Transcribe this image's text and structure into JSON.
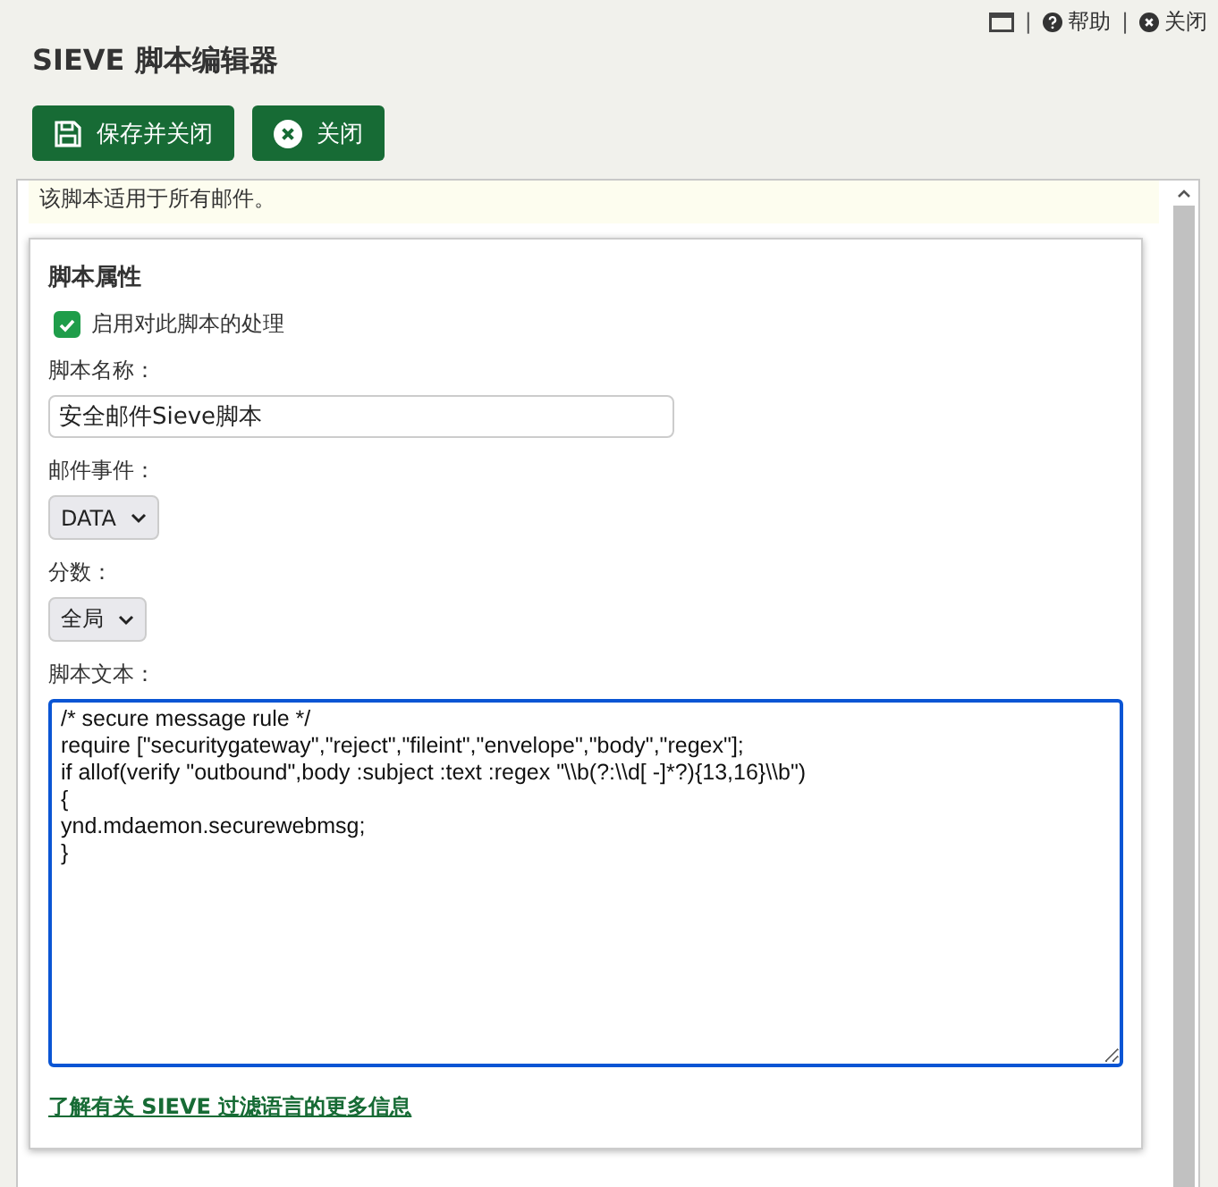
{
  "top_links": [
    {
      "kind": "window"
    },
    {
      "kind": "separator",
      "label": "|"
    },
    {
      "kind": "help",
      "label": "帮助"
    },
    {
      "kind": "separator",
      "label": "|"
    },
    {
      "kind": "close",
      "label": "关闭"
    }
  ],
  "title": "SIEVE 脚本编辑器",
  "buttons": [
    {
      "kind": "save",
      "label": "保存并关闭"
    },
    {
      "kind": "close",
      "label": "关闭"
    }
  ],
  "notice": "该脚本适用于所有邮件。",
  "card": {
    "heading": "脚本属性",
    "enable": {
      "label": "启用对此脚本的处理",
      "checked": true
    },
    "name_label": "脚本名称：",
    "name_value": "安全邮件Sieve脚本",
    "event_label": "邮件事件：",
    "event_value": "DATA",
    "score_label": "分数：",
    "score_value": "全局",
    "text_label": "脚本文本：",
    "script_lines": [
      "/* secure message rule */",
      "require [\"securitygateway\",\"reject\",\"fileint\",\"envelope\",\"body\",\"regex\"];",
      "if allof(verify \"outbound\",body :subject :text :regex \"\\\\b(?:\\\\d[ -]*?){13,16}\\\\b\")",
      "{",
      "ynd.mdaemon.securewebmsg;",
      "}"
    ],
    "link": "了解有关 SIEVE 过滤语言的更多信息"
  }
}
